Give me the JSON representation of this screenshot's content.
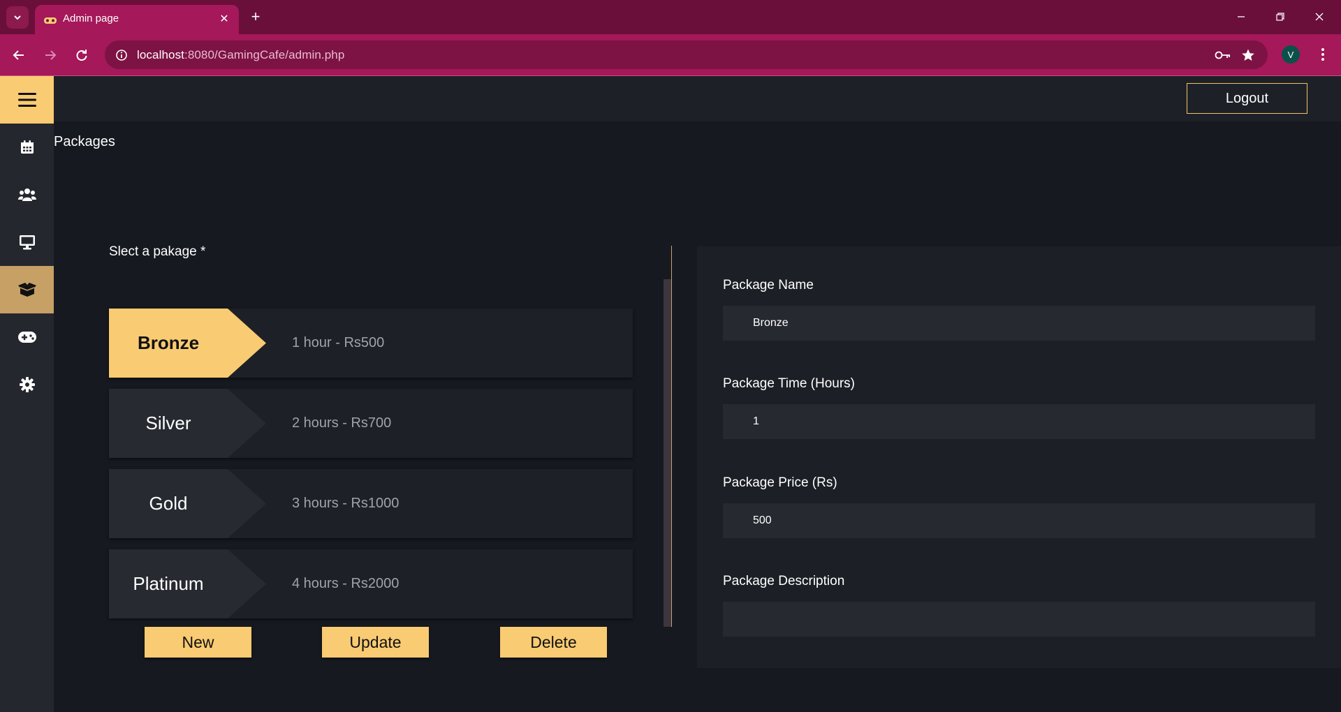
{
  "browser": {
    "tab_title": "Admin page",
    "url_host": "localhost",
    "url_rest": ":8080/GamingCafe/admin.php",
    "profile_initial": "V"
  },
  "header": {
    "logout_label": "Logout"
  },
  "page": {
    "title": "Packages",
    "select_label": "Slect a pakage *"
  },
  "sidebar": {
    "items": [
      {
        "icon": "hamburger-icon",
        "state": "active"
      },
      {
        "icon": "calendar-icon"
      },
      {
        "icon": "users-icon"
      },
      {
        "icon": "desktop-icon"
      },
      {
        "icon": "box-icon",
        "state": "selected"
      },
      {
        "icon": "gamepad-icon"
      },
      {
        "icon": "gear-icon"
      }
    ]
  },
  "packages": [
    {
      "name": "Bronze",
      "desc": "1 hour - Rs500",
      "active": true
    },
    {
      "name": "Silver",
      "desc": "2 hours - Rs700"
    },
    {
      "name": "Gold",
      "desc": "3 hours - Rs1000"
    },
    {
      "name": "Platinum",
      "desc": "4 hours - Rs2000"
    }
  ],
  "actions": {
    "new_label": "New",
    "update_label": "Update",
    "delete_label": "Delete"
  },
  "form": {
    "name_label": "Package Name",
    "name_value": "Bronze",
    "time_label": "Package Time (Hours)",
    "time_value": "1",
    "price_label": "Package Price (Rs)",
    "price_value": "500",
    "desc_label": "Package Description",
    "desc_value": ""
  },
  "colors": {
    "accent": "#f9cb72",
    "browser_frame": "#a5185a",
    "background": "#16191f"
  }
}
